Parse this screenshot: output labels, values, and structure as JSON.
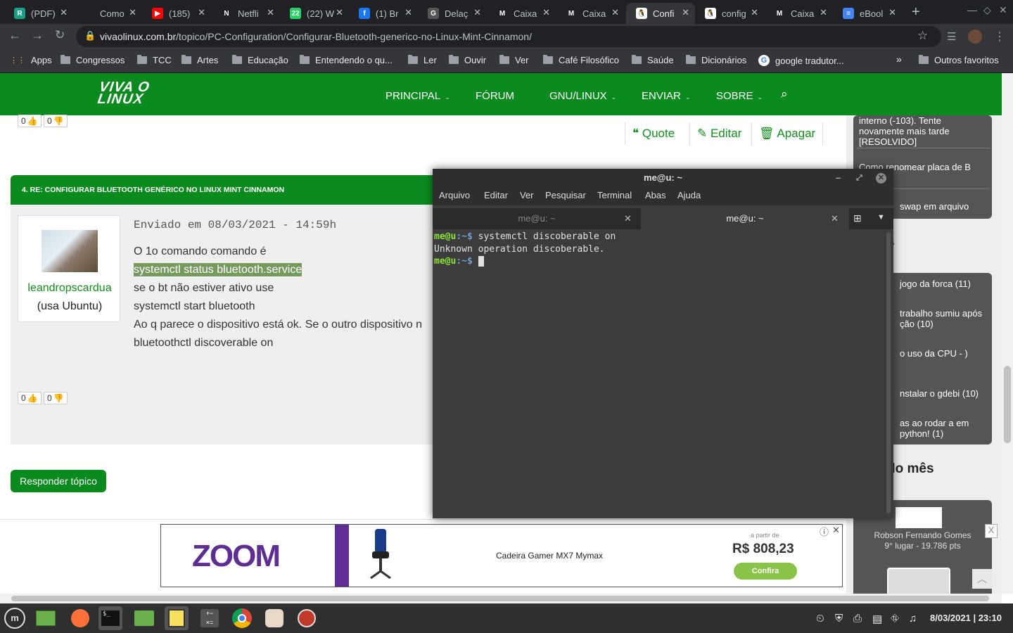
{
  "browser": {
    "tabs": [
      {
        "title": "(PDF)",
        "fav": "R",
        "color": "#1a9e85"
      },
      {
        "title": "Como",
        "fav": "",
        "color": "#202124"
      },
      {
        "title": "(185)",
        "fav": "▶",
        "color": "#ff0000"
      },
      {
        "title": "Netfli",
        "fav": "N",
        "color": "#202124"
      },
      {
        "title": "(22) W",
        "fav": "22",
        "color": "#25d366"
      },
      {
        "title": "(1) Br",
        "fav": "f",
        "color": "#1877f2"
      },
      {
        "title": "Delaç",
        "fav": "G",
        "color": "#555"
      },
      {
        "title": "Caixa",
        "fav": "M",
        "color": "#202124"
      },
      {
        "title": "Caixa",
        "fav": "M",
        "color": "#202124"
      },
      {
        "title": "Confi",
        "fav": "🐧",
        "color": "#fff"
      },
      {
        "title": "config",
        "fav": "🐧",
        "color": "#fff"
      },
      {
        "title": "Caixa",
        "fav": "M",
        "color": "#202124"
      },
      {
        "title": "eBool",
        "fav": "≡",
        "color": "#4285f4"
      }
    ],
    "active_tab_index": 9,
    "url_host": "vivaolinux.com.br",
    "url_path": "/topico/PC-Configuration/Configurar-Bluetooth-generico-no-Linux-Mint-Cinnamon/",
    "bookmarks": [
      "Apps",
      "Congressos",
      "TCC",
      "Artes",
      "Educação",
      "Entendendo o qu...",
      "Ler",
      "Ouvir",
      "Ver",
      "Café Filosófico",
      "Saúde",
      "Dicionários",
      "google tradutor..."
    ],
    "other_bookmarks": "Outros favoritos",
    "overflow": "»"
  },
  "site": {
    "logo_line1": "VIVA O",
    "logo_line2": "LINUX",
    "nav": [
      "PRINCIPAL",
      "FÓRUM",
      "GNU/LINUX",
      "ENVIAR",
      "SOBRE"
    ],
    "nav_caret": "⌄"
  },
  "prev_post": {
    "likes": "0",
    "dislikes": "0",
    "actions": [
      "Quote",
      "Editar",
      "Apagar"
    ]
  },
  "post": {
    "title": "4. RE: CONFIGURAR BLUETOOTH GENÉRICO NO LINUX MINT CINNAMON",
    "author": "leandropscardua",
    "distro": "(usa Ubuntu)",
    "date": "Enviado em 08/03/2021 - 14:59h",
    "lines": [
      "O 1o comando comando é",
      "systemctl status bluetooth.service",
      "se o bt não estiver ativo use",
      "systemctl start bluetooth",
      "Ao q parece o dispositivo está ok. Se o outro dispositivo n",
      "bluetoothctl discoverable on"
    ],
    "likes": "0",
    "dislikes": "0"
  },
  "reply_button": "Responder tópico",
  "sidebar": {
    "top_items": [
      "interno (-103). Tente novamente mais tarde [RESOLVIDO]",
      "Como renomear placa de B",
      "swap em arquivo"
    ],
    "section2_head": "s",
    "mid_items": [
      "jogo da forca (11)",
      "trabalho sumiu após ção (10)",
      "o uso da CPU - )",
      "nstalar o gdebi (10)",
      "as ao rodar a em python! (1)"
    ],
    "section3_head": "do mês",
    "user_name": "Robson Fernando Gomes",
    "user_rank": "9° lugar - 19.786 pts"
  },
  "ad": {
    "brand": "ZOOM",
    "product": "Cadeira Gamer MX7 Mymax",
    "from_label": "a partir de",
    "price": "R$ 808,23",
    "cta": "Confira",
    "close": "X"
  },
  "terminal": {
    "title": "me@u: ~",
    "menu": [
      "Arquivo",
      "Editar",
      "Ver",
      "Pesquisar",
      "Terminal",
      "Abas",
      "Ajuda"
    ],
    "tabs": [
      "me@u: ~",
      "me@u: ~"
    ],
    "prompt_user": "me@u",
    "prompt_path": ":~$",
    "command": " systemctl discoberable on",
    "output": "Unknown operation discoberable."
  },
  "taskbar": {
    "clock": "8/03/2021 | 23:10"
  }
}
